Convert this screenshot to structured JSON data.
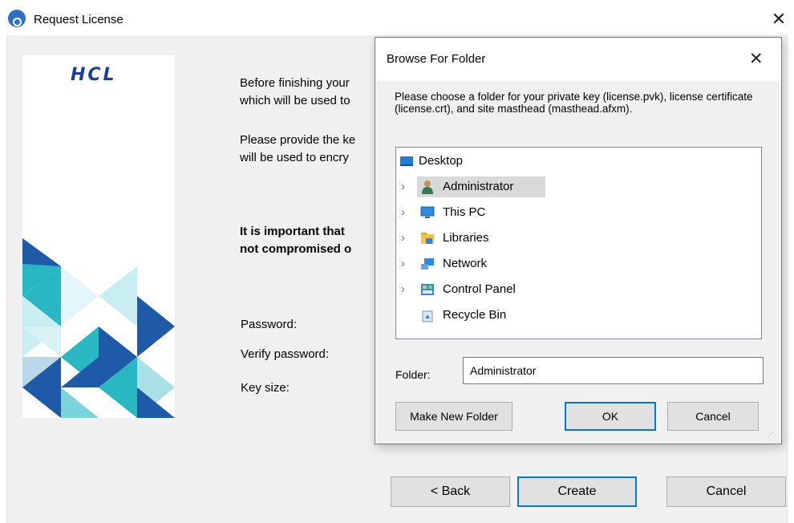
{
  "window": {
    "title": "Request License",
    "close_glyph": "✕"
  },
  "brand": {
    "logo_text": "HCL"
  },
  "main": {
    "para1_line1": "Before finishing your",
    "para1_line2": "which will be used to",
    "para2_line1": "Please provide the ke",
    "para2_line2": "will be used to encry",
    "warn_line1": "It is important that",
    "warn_line2": "not compromised o",
    "password_label": "Password:",
    "verify_label": "Verify password:",
    "keysize_label": "Key size:"
  },
  "footer": {
    "back_label": "< Back",
    "create_label": "Create",
    "cancel_label": "Cancel"
  },
  "dialog": {
    "title": "Browse For Folder",
    "close_glyph": "✕",
    "description": "Please choose a folder for your private key (license.pvk), license certificate (license.crt), and site masthead (masthead.afxm).",
    "tree": [
      {
        "label": "Desktop",
        "icon": "desktop-icon",
        "expandable": false,
        "selected": false
      },
      {
        "label": "Administrator",
        "icon": "user-icon",
        "expandable": true,
        "selected": true
      },
      {
        "label": "This PC",
        "icon": "computer-icon",
        "expandable": true,
        "selected": false
      },
      {
        "label": "Libraries",
        "icon": "libraries-icon",
        "expandable": true,
        "selected": false
      },
      {
        "label": "Network",
        "icon": "network-icon",
        "expandable": true,
        "selected": false
      },
      {
        "label": "Control Panel",
        "icon": "control-panel-icon",
        "expandable": true,
        "selected": false
      },
      {
        "label": "Recycle Bin",
        "icon": "recycle-bin-icon",
        "expandable": false,
        "selected": false
      }
    ],
    "folder_label": "Folder:",
    "folder_value": "Administrator",
    "make_new_folder_label": "Make New Folder",
    "ok_label": "OK",
    "cancel_label": "Cancel"
  },
  "colors": {
    "accent": "#0078d7",
    "brand_blue": "#1c3f9e",
    "teal": "#2ab7c4",
    "navy": "#1f5aa8"
  }
}
